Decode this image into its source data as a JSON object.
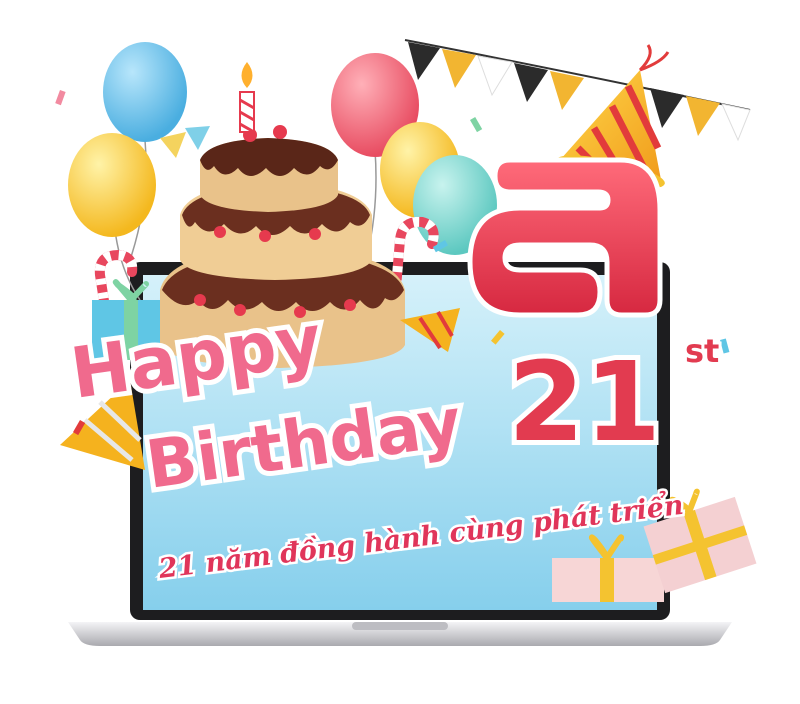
{
  "greeting": {
    "line1": "Happy",
    "line2": "Birthday"
  },
  "anniversary": {
    "number": "21",
    "suffix": "st"
  },
  "tagline": "21 năm đồng hành cùng phát triển",
  "colors": {
    "screen_top": "#c9ecf7",
    "screen_bottom": "#8fd3ee",
    "pink_text": "#f06a8d",
    "red_logo": "#e03a4f",
    "tagline": "#e0355a",
    "laptop_body": "#d8d8dc",
    "bezel": "#1d1d1f"
  },
  "icons": [
    "logo-icon",
    "birthday-cake-icon",
    "party-hat-icon",
    "gift-box-icon",
    "balloon-icon",
    "bunting-flag-icon",
    "candy-cane-icon"
  ]
}
